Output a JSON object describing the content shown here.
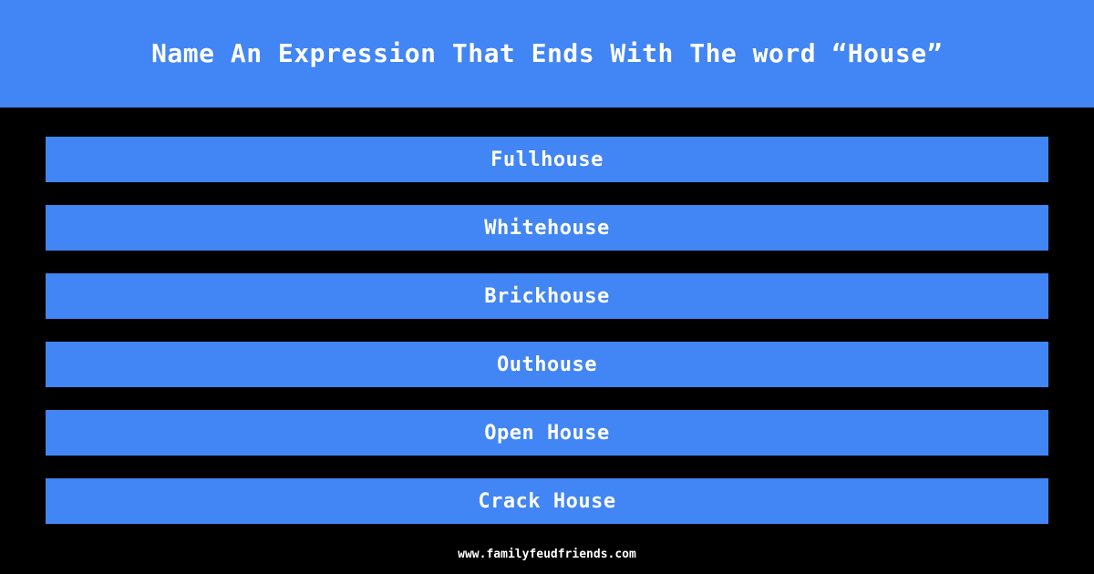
{
  "theme": {
    "background_color": "#000000",
    "accent_color": "#4285f4",
    "text_color": "#ffffff"
  },
  "header": {
    "question": "Name An Expression That Ends With The word “House”"
  },
  "answers": [
    {
      "label": "Fullhouse"
    },
    {
      "label": "Whitehouse"
    },
    {
      "label": "Brickhouse"
    },
    {
      "label": "Outhouse"
    },
    {
      "label": "Open House"
    },
    {
      "label": "Crack House"
    }
  ],
  "footer": {
    "site": "www.familyfeudfriends.com"
  }
}
